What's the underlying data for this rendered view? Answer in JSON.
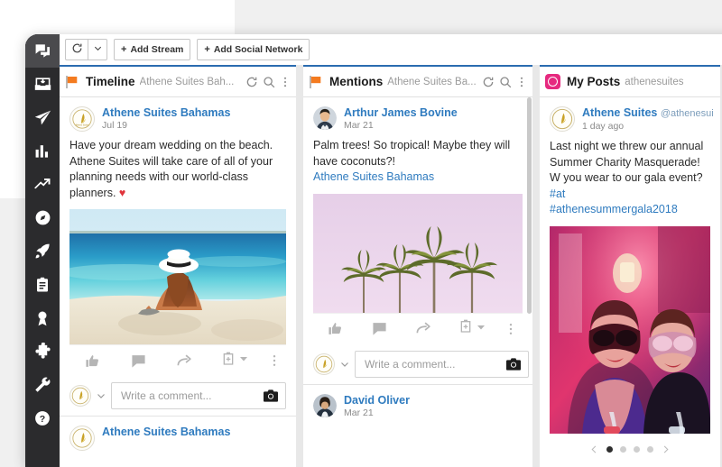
{
  "app": {
    "accent_blue": "#2b6cb0",
    "frame_color": "#2b2b2d",
    "link_color": "#2f7bbf",
    "instagram_pink": "#e6297f",
    "flag_orange": "#f47b20"
  },
  "sidebar": {
    "items": [
      {
        "name": "messages-icon",
        "label": "Messages",
        "active": true
      },
      {
        "name": "inbox-icon",
        "label": "Inbox",
        "active": false
      },
      {
        "name": "publisher-icon",
        "label": "Publisher",
        "active": false
      },
      {
        "name": "analytics-icon",
        "label": "Analytics",
        "active": false
      },
      {
        "name": "trends-icon",
        "label": "Trends",
        "active": false
      },
      {
        "name": "discovery-icon",
        "label": "Discovery",
        "active": false
      },
      {
        "name": "rocket-icon",
        "label": "Boost",
        "active": false
      },
      {
        "name": "clipboard-icon",
        "label": "Tasks",
        "active": false
      },
      {
        "name": "award-icon",
        "label": "Awards",
        "active": false
      },
      {
        "name": "puzzle-icon",
        "label": "Apps",
        "active": false
      },
      {
        "name": "wrench-icon",
        "label": "Settings",
        "active": false
      },
      {
        "name": "help-icon",
        "label": "Help",
        "active": false
      }
    ]
  },
  "toolbar": {
    "refresh_icon": "refresh-icon",
    "caret_icon": "chevron-down-icon",
    "add_stream_label": "Add Stream",
    "add_social_network_label": "Add Social Network",
    "plus": "+"
  },
  "columns": [
    {
      "id": "timeline",
      "icon": "flag-icon",
      "title": "Timeline",
      "subtitle": "Athene Suites Bah...",
      "head_actions": [
        "refresh-icon",
        "search-icon",
        "more-vertical-icon"
      ],
      "posts": [
        {
          "author": "Athene Suites Bahamas",
          "handle": "",
          "date": "Jul 19",
          "avatar": "athene-logo",
          "text": "Have your dream wedding on the beach. Athene Suites will take care of all of your planning needs with our world-class planners. ",
          "emoji": "♥",
          "link_text": "",
          "media": "beach-photo",
          "actions": [
            "like-icon",
            "comment-icon",
            "share-icon",
            "add-to-queue-icon",
            "more-vertical-icon"
          ],
          "comment_placeholder": "Write a comment...",
          "camera_icon": "camera-icon"
        },
        {
          "author": "Athene Suites Bahamas",
          "handle": "",
          "date": "",
          "avatar": "athene-logo",
          "text": "",
          "media": "",
          "actions": [],
          "comment_placeholder": "",
          "camera_icon": ""
        }
      ]
    },
    {
      "id": "mentions",
      "icon": "flag-icon",
      "title": "Mentions",
      "subtitle": "Athene Suites Ba...",
      "head_actions": [
        "refresh-icon",
        "search-icon",
        "more-vertical-icon"
      ],
      "posts": [
        {
          "author": "Arthur James Bovine",
          "handle": "",
          "date": "Mar 21",
          "avatar": "man-photo",
          "text": "Palm trees! So tropical! Maybe they will have coconuts?!",
          "emoji": "",
          "link_text": "Athene Suites Bahamas",
          "media": "palm-trees-photo",
          "actions": [
            "like-icon",
            "comment-icon",
            "share-icon",
            "add-to-queue-icon",
            "more-vertical-icon"
          ],
          "comment_placeholder": "Write a comment...",
          "camera_icon": "camera-icon"
        },
        {
          "author": "David Oliver",
          "handle": "",
          "date": "Mar 21",
          "avatar": "woman-photo",
          "text": "",
          "media": "",
          "actions": [],
          "comment_placeholder": "",
          "camera_icon": ""
        }
      ]
    },
    {
      "id": "my-posts",
      "icon": "instagram-icon",
      "title": "My Posts",
      "subtitle": "athenesuites",
      "head_actions": [],
      "posts": [
        {
          "author": "Athene Suites",
          "handle": "@athenesui",
          "date": "1 day ago",
          "avatar": "athene-logo",
          "text": "Last night we threw our annual Summer Charity Masquerade! W you wear to our gala event? ",
          "hashtag_partial": "#at",
          "hashtag": "#athenesummergala2018",
          "media": "masquerade-photo",
          "carousel": {
            "prev_icon": "chevron-left-icon",
            "next_icon": "chevron-right-icon",
            "dots": 4,
            "active_dot": 1
          }
        }
      ]
    }
  ]
}
